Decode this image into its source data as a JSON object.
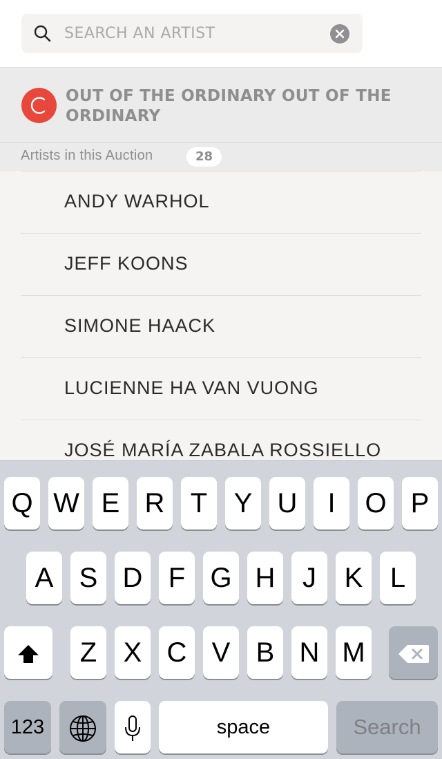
{
  "search": {
    "placeholder": "SEARCH AN ARTIST",
    "value": ""
  },
  "auction": {
    "logo_letter": "C",
    "title": "OUT OF THE ORDINARY OUT OF THE ORDINARY"
  },
  "section": {
    "label": "Artists in this Auction",
    "count": "28"
  },
  "artists": [
    "ANDY WARHOL",
    "JEFF KOONS",
    "SIMONE HAACK",
    "LUCIENNE HA VAN VUONG",
    "JOSÉ MARÍA ZABALA ROSSIELLO"
  ],
  "keyboard": {
    "row1": [
      "Q",
      "W",
      "E",
      "R",
      "T",
      "Y",
      "U",
      "I",
      "O",
      "P"
    ],
    "row2": [
      "A",
      "S",
      "D",
      "F",
      "G",
      "H",
      "J",
      "K",
      "L"
    ],
    "row3": [
      "Z",
      "X",
      "C",
      "V",
      "B",
      "N",
      "M"
    ],
    "numbers_label": "123",
    "space_label": "space",
    "return_label": "Search",
    "icons": {
      "shift": "shift-icon",
      "delete": "backspace-icon",
      "globe": "globe-icon",
      "mic": "microphone-icon"
    }
  },
  "colors": {
    "accent": "#e8473c",
    "header_bg": "#ebebeb",
    "list_bg": "#f5f4f2",
    "keyboard_bg": "#d1d5db"
  }
}
